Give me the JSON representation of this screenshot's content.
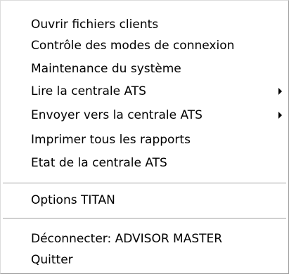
{
  "menu": {
    "items": [
      {
        "label": "Ouvrir fichiers clients",
        "submenu": false
      },
      {
        "label": "Contrôle des modes de connexion",
        "submenu": false
      },
      {
        "label": "Maintenance du système",
        "submenu": false
      },
      {
        "label": "Lire la centrale ATS",
        "submenu": true
      },
      {
        "label": "Envoyer vers la centrale ATS",
        "submenu": true
      },
      {
        "label": "Imprimer tous les rapports",
        "submenu": false
      },
      {
        "label": "Etat de la centrale ATS",
        "submenu": false
      },
      {
        "label": "Options TITAN",
        "submenu": false
      },
      {
        "label": "Déconnecter: ADVISOR MASTER",
        "submenu": false
      },
      {
        "label": "Quitter",
        "submenu": false
      }
    ],
    "submenu_icon": "triangle-right-icon"
  }
}
